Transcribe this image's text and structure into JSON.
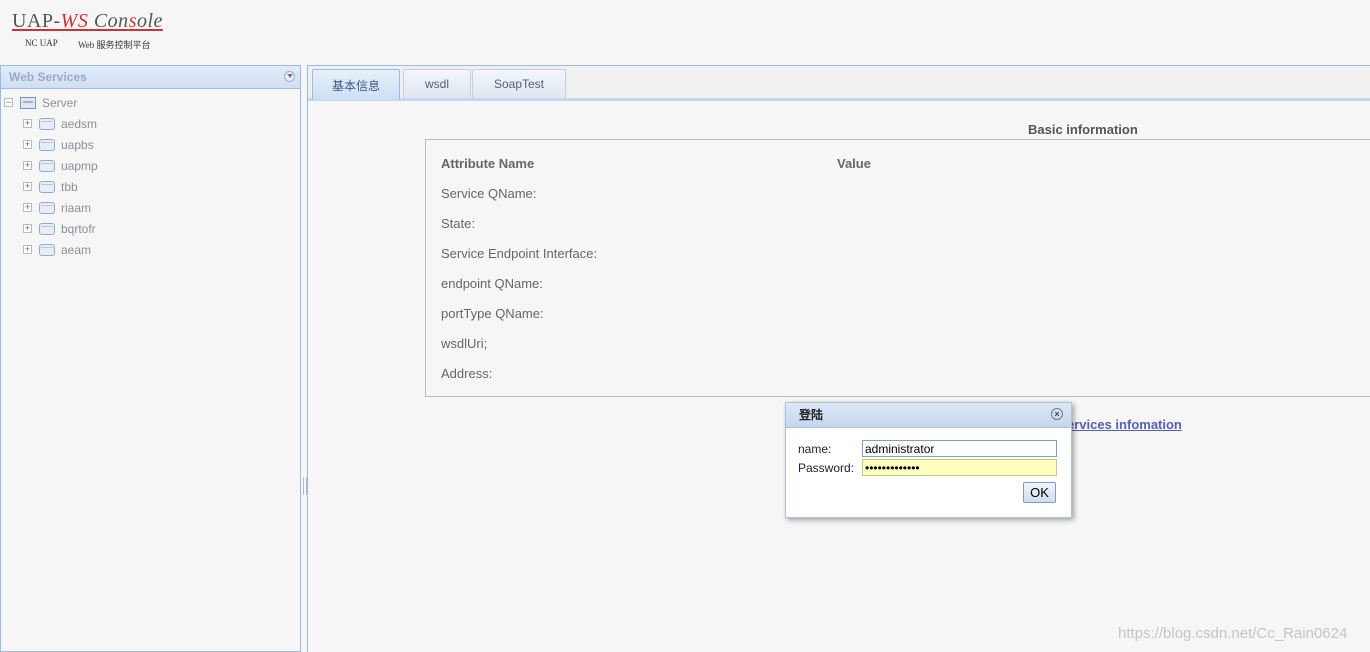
{
  "header": {
    "logo_prefix": "UAP-",
    "logo_ws": "WS",
    "logo_con": " Con",
    "logo_s": "s",
    "logo_ole": "ole",
    "subtitle_left": "NC UAP",
    "subtitle_right": "Web 服务控制平台"
  },
  "sidebar": {
    "title": "Web Services",
    "root": "Server",
    "items": [
      "aedsm",
      "uapbs",
      "uapmp",
      "tbb",
      "riaam",
      "bqrtofr",
      "aeam"
    ]
  },
  "tabs": [
    "基本信息",
    "wsdl",
    "SoapTest"
  ],
  "basic": {
    "title": "Basic information",
    "col_attr": "Attribute Name",
    "col_value": "Value",
    "rows": [
      "Service QName:",
      "State:",
      "Service Endpoint Interface:",
      "endpoint QName:",
      "portType QName:",
      "wsdlUri;",
      "Address:"
    ]
  },
  "link_text": "ervices infomation",
  "dialog": {
    "title": "登陆",
    "close_glyph": "×",
    "name_label": "name:",
    "name_value": "administrator",
    "password_label": "Password:",
    "password_value": "xxxxxxxxxxxxx",
    "ok_label": "OK"
  },
  "watermark": "https://blog.csdn.net/Cc_Rain0624",
  "colors": {
    "panel_border": "#99bbe8",
    "accent_red": "#cc3333",
    "link": "#5560b4",
    "password_bg": "#ffffc0"
  }
}
